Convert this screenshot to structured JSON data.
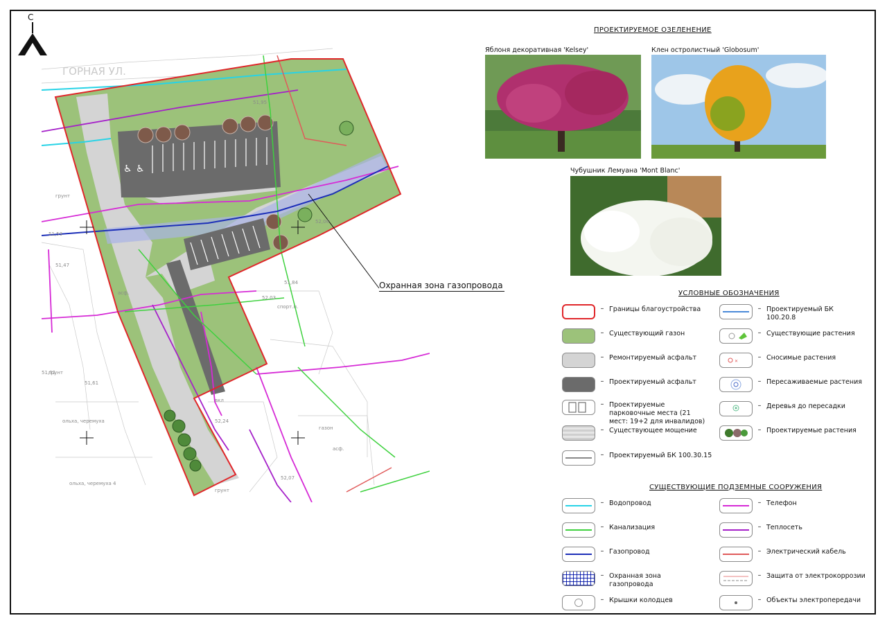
{
  "north": {
    "letter": "С"
  },
  "plan": {
    "street_label": "ГОРНАЯ УЛ.",
    "gas_zone_callout": "Охранная зона газопровода",
    "text_labels": [
      "грунт",
      "асф.",
      "спорт.п.",
      "грунт",
      "ольха, черемуха",
      "ольха, черемуха 4",
      "грунт",
      "газон",
      "асф.",
      "52,06",
      "51,95",
      "51,84",
      "52,03",
      "51,61",
      "51,92",
      "52,24",
      "52,07",
      "51,47",
      "51,53",
      "вкл"
    ]
  },
  "greening": {
    "title": "ПРОЕКТИРУЕМОЕ ОЗЕЛЕНЕНИЕ",
    "plants": [
      {
        "caption": "Яблоня декоративная 'Kelsey'"
      },
      {
        "caption": "Клен остролистный 'Globosum'"
      },
      {
        "caption": "Чубушник Лемуана 'Mont Blanc'"
      }
    ]
  },
  "legend": {
    "title": "УСЛОВНЫЕ ОБОЗНАЧЕНИЯ",
    "left": [
      {
        "dash": "–",
        "label": "Границы благоустройства"
      },
      {
        "dash": "–",
        "label": "Существующий газон"
      },
      {
        "dash": "–",
        "label": "Ремонтируемый асфальт"
      },
      {
        "dash": "–",
        "label": "Проектируемый асфальт"
      },
      {
        "dash": "–",
        "label": "Проектируемые парковочные места (21 мест: 19+2 для инвалидов)"
      },
      {
        "dash": "–",
        "label": "Существующее мощение"
      },
      {
        "dash": "–",
        "label": "Проектируемый БК 100.30.15"
      }
    ],
    "right": [
      {
        "dash": "–",
        "label": "Проектируемый БК 100.20.8"
      },
      {
        "dash": "–",
        "label": "Существующие растения"
      },
      {
        "dash": "–",
        "label": "Сносимые растения"
      },
      {
        "dash": "–",
        "label": "Пересаживаемые растения"
      },
      {
        "dash": "–",
        "label": "Деревья до пересадки"
      },
      {
        "dash": "–",
        "label": "Проектируемые растения"
      }
    ]
  },
  "underground": {
    "title": "СУЩЕСТВУЮЩИЕ ПОДЗЕМНЫЕ СООРУЖЕНИЯ",
    "left": [
      {
        "dash": "–",
        "label": "Водопровод"
      },
      {
        "dash": "–",
        "label": "Канализация"
      },
      {
        "dash": "–",
        "label": "Газопровод"
      },
      {
        "dash": "–",
        "label": "Охранная зона газопровода"
      },
      {
        "dash": "–",
        "label": "Крышки колодцев"
      }
    ],
    "right": [
      {
        "dash": "–",
        "label": "Телефон"
      },
      {
        "dash": "–",
        "label": "Теплосеть"
      },
      {
        "dash": "–",
        "label": "Электрический кабель"
      },
      {
        "dash": "–",
        "label": "Защита от электрокоррозии"
      },
      {
        "dash": "–",
        "label": "Объекты электропередачи"
      }
    ]
  },
  "colors": {
    "boundary": "#e0262a",
    "lawn": "#9cc27a",
    "repair_asphalt": "#d4d4d4",
    "new_asphalt": "#6b6b6b",
    "water": "#27d3e6",
    "sewer": "#3ed13e",
    "gas": "#1c2fb8",
    "telephone": "#d62ad6",
    "heating": "#a520c9",
    "electric": "#e05a5a"
  }
}
